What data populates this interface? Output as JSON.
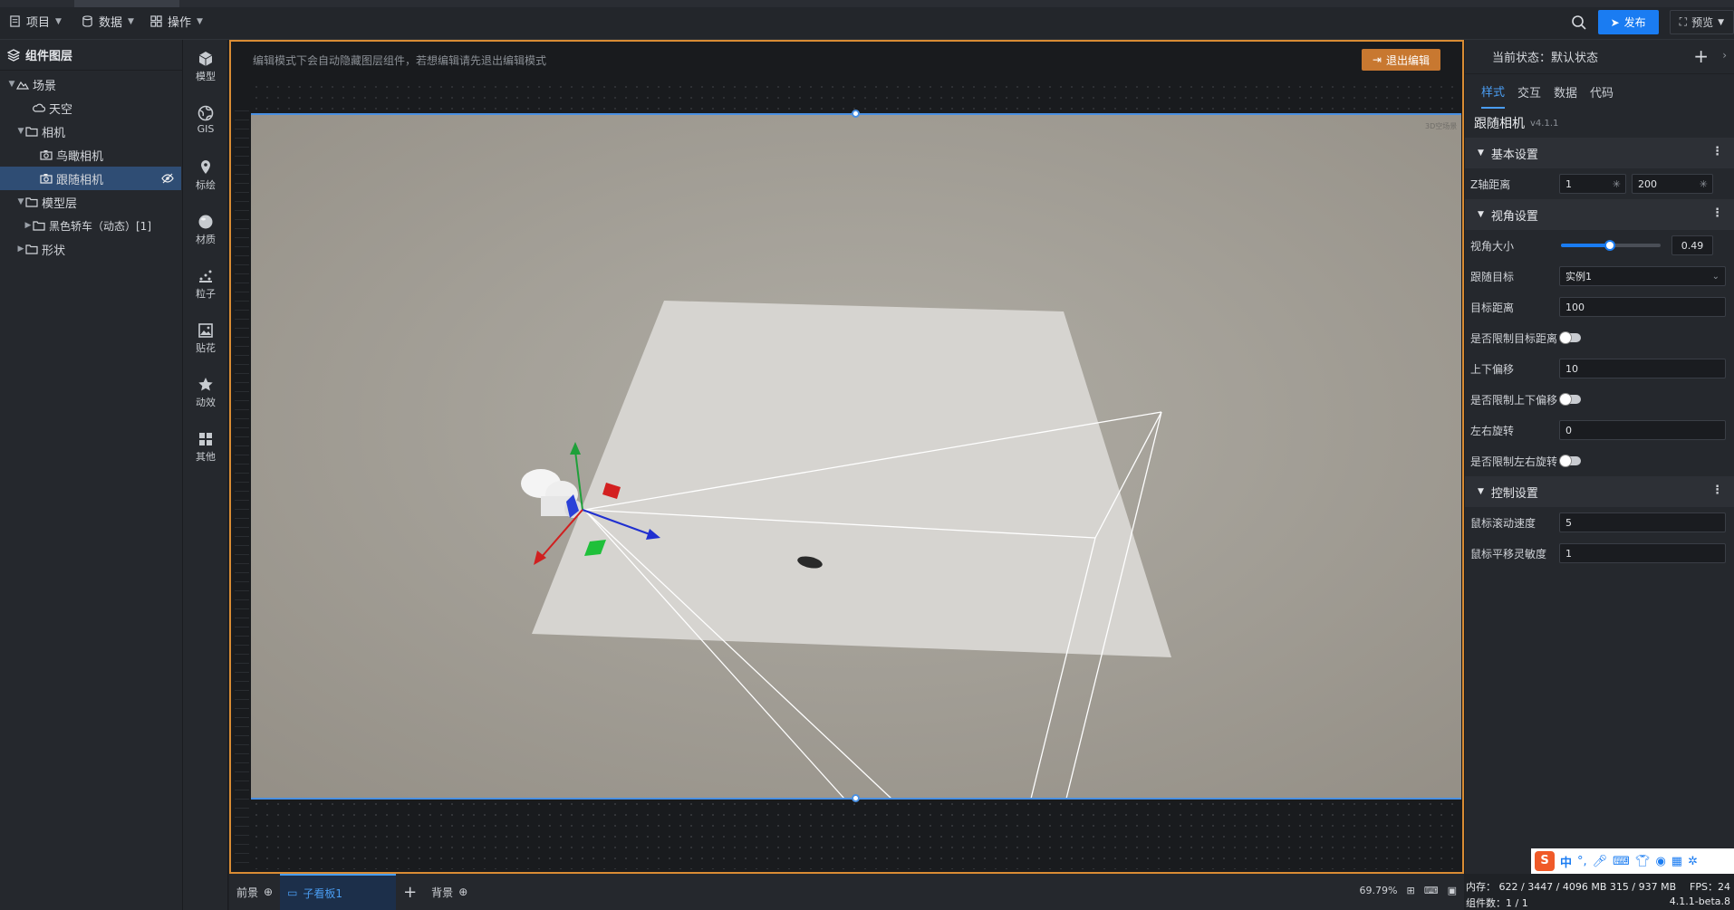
{
  "topbar": {
    "menu": [
      {
        "label": "项目",
        "icon": "file-icon"
      },
      {
        "label": "数据",
        "icon": "database-icon"
      },
      {
        "label": "操作",
        "icon": "grid-icon"
      }
    ],
    "publish": "发布",
    "preview": "预览"
  },
  "layers": {
    "title": "组件图层",
    "items": [
      {
        "label": "场景",
        "level": 0,
        "expanded": true,
        "icon": "mountain-icon"
      },
      {
        "label": "天空",
        "level": 1,
        "icon": "cloud-icon"
      },
      {
        "label": "相机",
        "level": 1,
        "expanded": true,
        "icon": "folder-icon"
      },
      {
        "label": "鸟瞰相机",
        "level": 2,
        "icon": "camera-icon"
      },
      {
        "label": "跟随相机",
        "level": 2,
        "icon": "camera-icon",
        "selected": true
      },
      {
        "label": "模型层",
        "level": 1,
        "expanded": true,
        "icon": "folder-icon"
      },
      {
        "label": "黑色轿车（动态）[1]",
        "level": 2,
        "icon": "folder-icon",
        "collapsed": true
      },
      {
        "label": "形状",
        "level": 1,
        "icon": "folder-icon",
        "collapsed": true
      }
    ]
  },
  "sidebar_icons": [
    {
      "label": "模型",
      "icon": "cube-icon"
    },
    {
      "label": "GIS",
      "icon": "globe-icon"
    },
    {
      "label": "标绘",
      "icon": "pin-icon"
    },
    {
      "label": "材质",
      "icon": "sphere-icon"
    },
    {
      "label": "粒子",
      "icon": "particle-icon"
    },
    {
      "label": "贴花",
      "icon": "image-icon"
    },
    {
      "label": "动效",
      "icon": "star-icon"
    },
    {
      "label": "其他",
      "icon": "apps-icon"
    }
  ],
  "editor": {
    "notice": "编辑模式下会自动隐藏图层组件，若想编辑请先退出编辑模式",
    "exit_button": "退出编辑",
    "scene_tag": "3D空场景"
  },
  "bottom": {
    "tabs": [
      "前景",
      "子看板1",
      "背景"
    ],
    "active_tab": "子看板1",
    "zoom": "69.79%"
  },
  "properties": {
    "state_label": "当前状态：默认状态",
    "tabs": [
      "样式",
      "交互",
      "数据",
      "代码"
    ],
    "active_tab": "样式",
    "component_name": "跟随相机",
    "version": "v4.1.1",
    "sections": [
      {
        "title": "基本设置",
        "rows": [
          {
            "label": "Z轴距离",
            "type": "range",
            "values": [
              "1",
              "200"
            ]
          }
        ]
      },
      {
        "title": "视角设置",
        "rows": [
          {
            "label": "视角大小",
            "type": "slider",
            "value": "0.49",
            "fraction": 0.49
          },
          {
            "label": "跟随目标",
            "type": "select",
            "value": "实例1"
          },
          {
            "label": "目标距离",
            "type": "input",
            "value": "100"
          },
          {
            "label": "是否限制目标距离",
            "type": "toggle",
            "on": false
          },
          {
            "label": "上下偏移",
            "type": "input",
            "value": "10"
          },
          {
            "label": "是否限制上下偏移",
            "type": "toggle",
            "on": false
          },
          {
            "label": "左右旋转",
            "type": "input",
            "value": "0"
          },
          {
            "label": "是否限制左右旋转",
            "type": "toggle",
            "on": false
          }
        ]
      },
      {
        "title": "控制设置",
        "rows": [
          {
            "label": "鼠标滚动速度",
            "type": "input",
            "value": "5"
          },
          {
            "label": "鼠标平移灵敏度",
            "type": "input",
            "value": "1"
          }
        ]
      }
    ]
  },
  "status": {
    "memory": "内存：  622 / 3447 / 4096 MB  315 / 937 MB",
    "fps": "FPS：24",
    "component_count": "组件数：1 / 1",
    "version": "4.1.1-beta.8"
  },
  "ime": {
    "label": "中"
  },
  "colors": {
    "accent": "#1a7cf2",
    "exit_button": "#c87830",
    "canvas": "#9d9a91",
    "selection": "#2f4d74"
  }
}
